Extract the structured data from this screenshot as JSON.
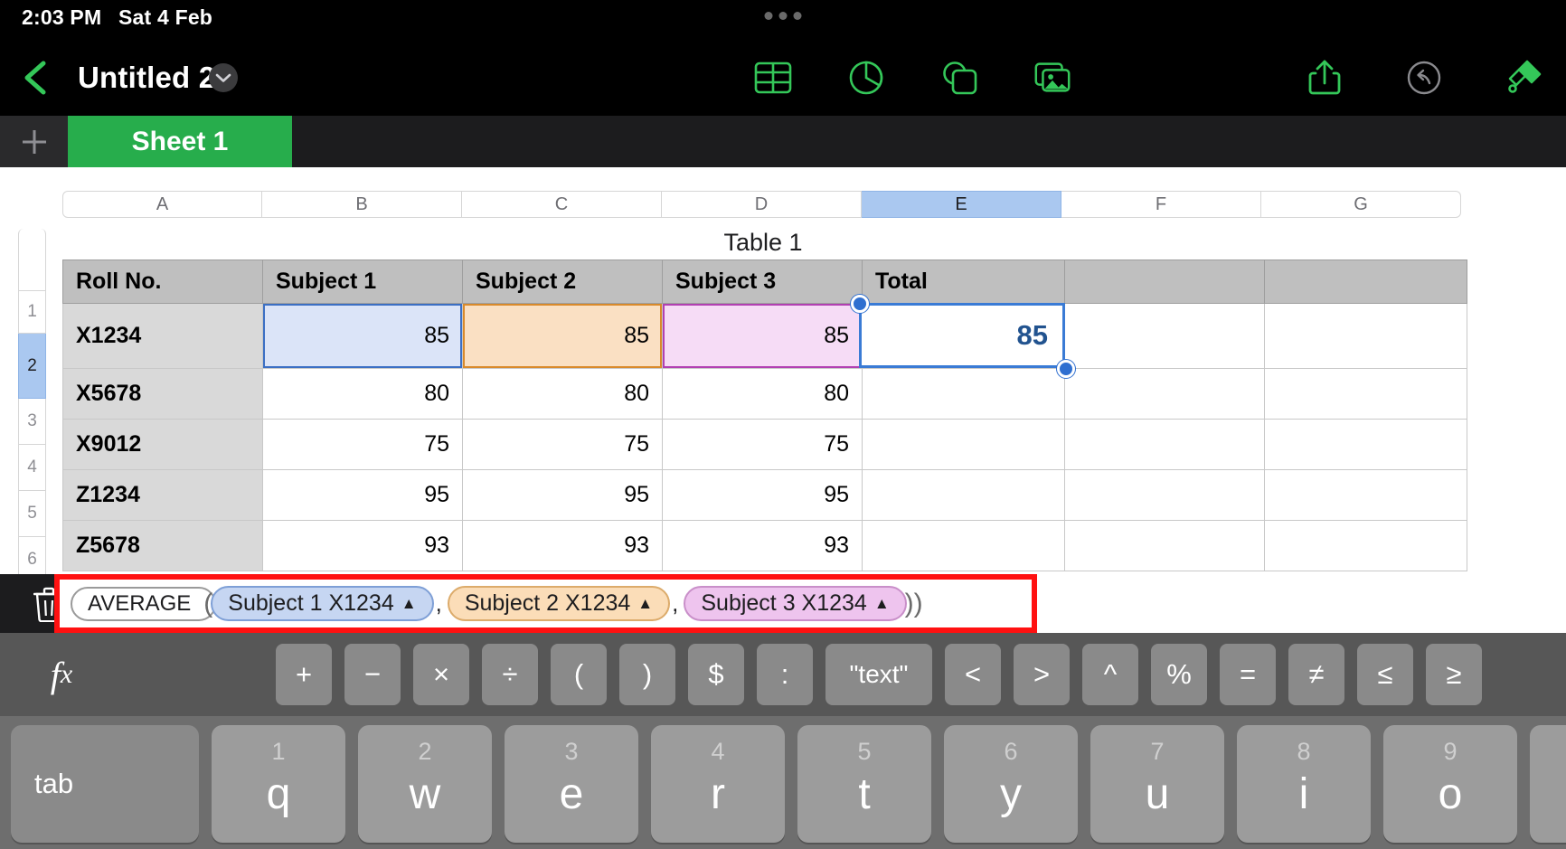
{
  "status_bar": {
    "time": "2:03 PM",
    "date": "Sat 4 Feb",
    "dots_icon": "three-dots-icon"
  },
  "nav_bar": {
    "back_icon": "chevron-left-icon",
    "title": "Untitled 2",
    "title_menu_icon": "chevron-down-icon",
    "center_tools": [
      {
        "name": "insert-table-icon",
        "label": "Table"
      },
      {
        "name": "insert-chart-icon",
        "label": "Chart"
      },
      {
        "name": "insert-shape-icon",
        "label": "Shape"
      },
      {
        "name": "insert-media-icon",
        "label": "Media"
      }
    ],
    "right_tools": [
      {
        "name": "share-icon",
        "label": "Share",
        "enabled": true
      },
      {
        "name": "undo-icon",
        "label": "Undo",
        "enabled": false
      },
      {
        "name": "format-brush-icon",
        "label": "Format",
        "enabled": true
      }
    ],
    "accent_color": "#34c759"
  },
  "tab_bar": {
    "add_sheet_icon": "plus-icon",
    "tabs": [
      {
        "label": "Sheet 1",
        "active": true
      }
    ],
    "active_color": "#27ad4c"
  },
  "spreadsheet": {
    "column_headers": [
      "A",
      "B",
      "C",
      "D",
      "E",
      "F",
      "G"
    ],
    "selected_column": "E",
    "row_headers": [
      "1",
      "2",
      "3",
      "4",
      "5",
      "6"
    ],
    "selected_row": "2",
    "table_title": "Table 1",
    "header_row": [
      "Roll No.",
      "Subject 1",
      "Subject 2",
      "Subject 3",
      "Total",
      "",
      ""
    ],
    "rows": [
      {
        "roll": "X1234",
        "s1": "85",
        "s2": "85",
        "s3": "85",
        "total": "",
        "f": "",
        "g": ""
      },
      {
        "roll": "X5678",
        "s1": "80",
        "s2": "80",
        "s3": "80",
        "total": "",
        "f": "",
        "g": ""
      },
      {
        "roll": "X9012",
        "s1": "75",
        "s2": "75",
        "s3": "75",
        "total": "",
        "f": "",
        "g": ""
      },
      {
        "roll": "Z1234",
        "s1": "95",
        "s2": "95",
        "s3": "95",
        "total": "",
        "f": "",
        "g": ""
      },
      {
        "roll": "Z5678",
        "s1": "93",
        "s2": "93",
        "s3": "93",
        "total": "",
        "f": "",
        "g": ""
      }
    ],
    "selected_cell": {
      "address": "E2",
      "display_value": "85",
      "border_color": "#3a7bd5"
    },
    "reference_highlights": [
      {
        "cell": "B2",
        "fill": "#dbe4f8",
        "stroke": "#3b6fc4"
      },
      {
        "cell": "C2",
        "fill": "#fae0c3",
        "stroke": "#d98a2b"
      },
      {
        "cell": "D2",
        "fill": "#f6dcf6",
        "stroke": "#b240b2"
      }
    ]
  },
  "formula_bar": {
    "delete_icon": "trash-icon",
    "highlight_color": "#ff1111",
    "function_name": "AVERAGE",
    "open_paren": "(",
    "close_paren": ")",
    "separator": ",",
    "token_caret_icon": "caret-up-icon",
    "tokens": [
      {
        "label": "Subject 1 X1234",
        "color": "#c6d6f2"
      },
      {
        "label": "Subject 2 X1234",
        "color": "#fbddb8"
      },
      {
        "label": "Subject 3 X1234",
        "color": "#eec4ee"
      }
    ]
  },
  "function_key_row": {
    "fx_icon": "fx-icon",
    "keys": [
      "+",
      "−",
      "×",
      "÷",
      "(",
      ")",
      "$",
      ":",
      "\"text\"",
      "<",
      ">",
      "^",
      "%",
      "=",
      "≠",
      "≤",
      "≥"
    ]
  },
  "keyboard": {
    "keys": [
      {
        "main": "tab",
        "sup": "",
        "wide": true
      },
      {
        "main": "q",
        "sup": "1"
      },
      {
        "main": "w",
        "sup": "2"
      },
      {
        "main": "e",
        "sup": "3"
      },
      {
        "main": "r",
        "sup": "4"
      },
      {
        "main": "t",
        "sup": "5"
      },
      {
        "main": "y",
        "sup": "6"
      },
      {
        "main": "u",
        "sup": "7"
      },
      {
        "main": "i",
        "sup": "8"
      },
      {
        "main": "o",
        "sup": "9"
      }
    ]
  }
}
